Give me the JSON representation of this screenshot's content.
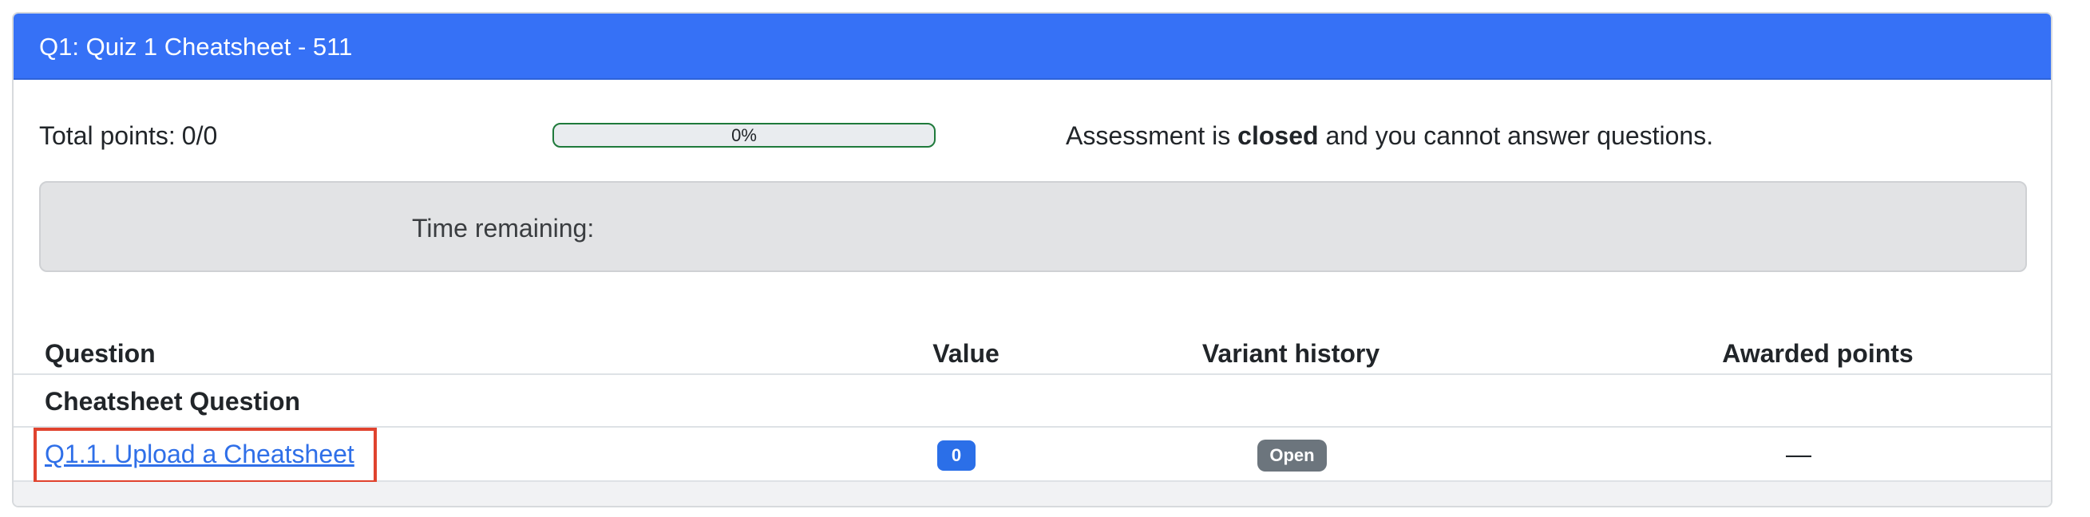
{
  "header": {
    "title": "Q1: Quiz 1 Cheatsheet - 511"
  },
  "summary": {
    "total_points_label": "Total points:",
    "total_points_value": "0/0",
    "progress_percent": 0,
    "progress_label": "0%",
    "status_prefix": "Assessment is",
    "status_emphasis": "closed",
    "status_suffix": "and you cannot answer questions."
  },
  "timer": {
    "label": "Time remaining:"
  },
  "table": {
    "columns": {
      "question": "Question",
      "value": "Value",
      "variant_history": "Variant history",
      "awarded_points": "Awarded points"
    },
    "group": {
      "title": "Cheatsheet Question"
    },
    "rows": [
      {
        "question": "Q1.1. Upload a Cheatsheet",
        "value": "0",
        "variant": "Open",
        "awarded": "—"
      }
    ]
  },
  "colors": {
    "header_bg": "#3671f6",
    "progress_border": "#1f7a3b",
    "link": "#2f6fe8",
    "value_badge": "#2b6fe8",
    "variant_badge": "#6c757d",
    "highlight": "#e0432e"
  }
}
